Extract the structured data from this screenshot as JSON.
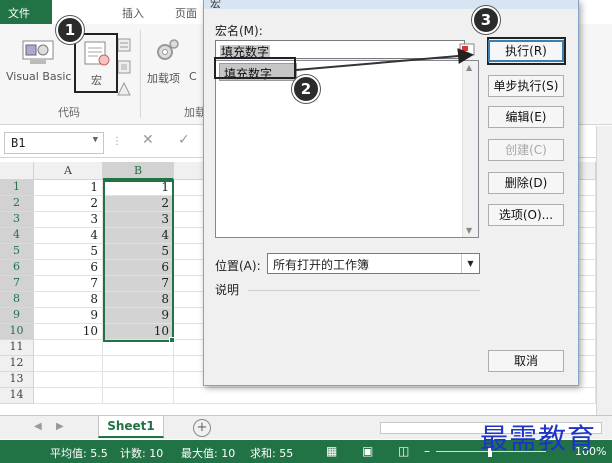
{
  "ribbon": {
    "file_tab": "文件",
    "tabs": [
      "插入",
      "页面"
    ],
    "visual_basic_label": "Visual Basic",
    "macro_label": "宏",
    "addins_label": "加载项",
    "addins2_label": "C",
    "group_code": "代码",
    "group_addins": "加载"
  },
  "formula_bar": {
    "name_box": "B1",
    "cancel_icon": "✕",
    "enter_icon": "✓"
  },
  "sheet": {
    "columns": [
      "A",
      "B"
    ],
    "rows": [
      {
        "n": "1",
        "a": "1",
        "b": "1"
      },
      {
        "n": "2",
        "a": "2",
        "b": "2"
      },
      {
        "n": "3",
        "a": "3",
        "b": "3"
      },
      {
        "n": "4",
        "a": "4",
        "b": "4"
      },
      {
        "n": "5",
        "a": "5",
        "b": "5"
      },
      {
        "n": "6",
        "a": "6",
        "b": "6"
      },
      {
        "n": "7",
        "a": "7",
        "b": "7"
      },
      {
        "n": "8",
        "a": "8",
        "b": "8"
      },
      {
        "n": "9",
        "a": "9",
        "b": "9"
      },
      {
        "n": "10",
        "a": "10",
        "b": "10"
      },
      {
        "n": "11",
        "a": "",
        "b": ""
      },
      {
        "n": "12",
        "a": "",
        "b": ""
      },
      {
        "n": "13",
        "a": "",
        "b": ""
      },
      {
        "n": "14",
        "a": "",
        "b": ""
      }
    ],
    "tab_name": "Sheet1",
    "add_sheet": "+"
  },
  "status": {
    "average": "平均值: 5.5",
    "count": "计数: 10",
    "max": "最大值: 10",
    "sum": "求和: 55",
    "zoom": "100%"
  },
  "dialog": {
    "title": "宏",
    "macro_name_label": "宏名(M):",
    "macro_name_value": "填充数字",
    "macro_list": [
      "填充数字"
    ],
    "buttons": {
      "run": "执行(R)",
      "step_into": "单步执行(S)",
      "edit": "编辑(E)",
      "create": "创建(C)",
      "delete": "删除(D)",
      "options": "选项(O)...",
      "cancel": "取消"
    },
    "location_label": "位置(A):",
    "location_value": "所有打开的工作簿",
    "description_label": "说明"
  },
  "annotations": [
    "1",
    "2",
    "3"
  ],
  "watermark": "最需教育",
  "colors": {
    "excel_green": "#217346",
    "selection_gray": "#d3d3d3",
    "badge": "#2b2b2b",
    "watermark": "#1c33c8"
  }
}
